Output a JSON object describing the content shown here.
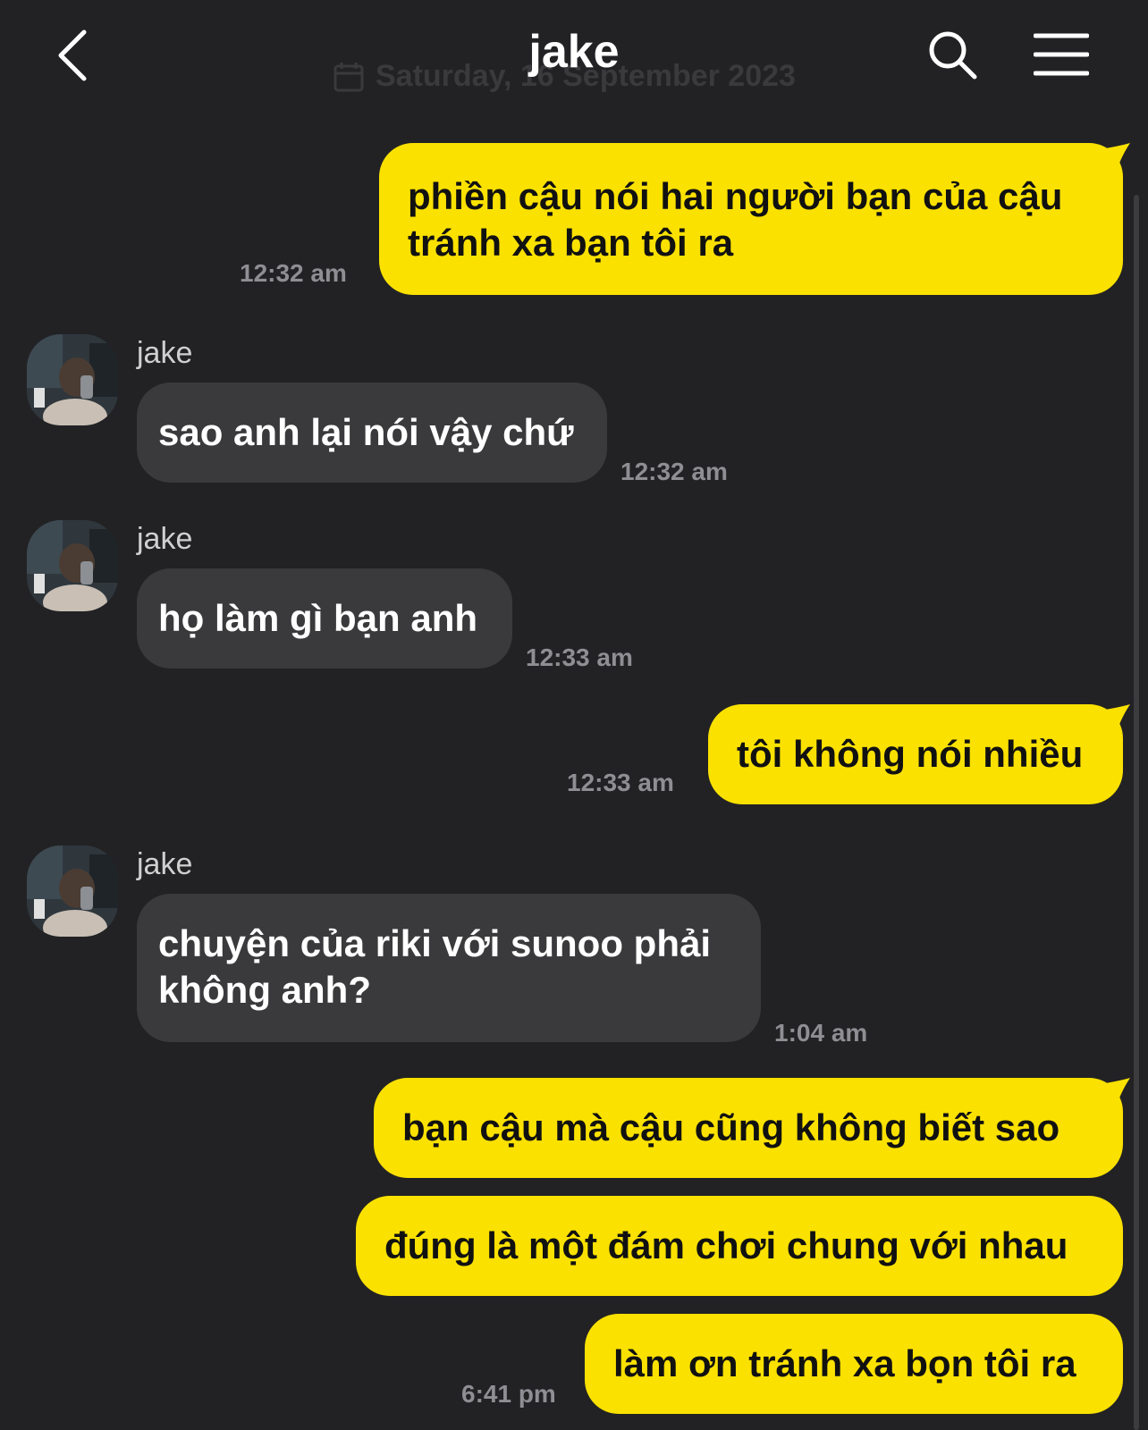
{
  "header": {
    "title": "jake",
    "date": "Saturday, 16 September 2023"
  },
  "messages": [
    {
      "direction": "out",
      "text": "phiền cậu nói hai người bạn của cậu tránh xa bạn tôi ra",
      "time": "12:32 am"
    },
    {
      "direction": "in",
      "sender": "jake",
      "text": "sao anh lại nói vậy chứ",
      "time": "12:32 am"
    },
    {
      "direction": "in",
      "sender": "jake",
      "text": "họ làm gì bạn anh",
      "time": "12:33 am"
    },
    {
      "direction": "out",
      "text": "tôi không nói nhiều",
      "time": "12:33 am"
    },
    {
      "direction": "in",
      "sender": "jake",
      "text": "chuyện của riki với sunoo phải không anh?",
      "time": "1:04 am"
    },
    {
      "direction": "out",
      "text": "bạn cậu mà cậu cũng không biết sao",
      "time": ""
    },
    {
      "direction": "out",
      "text": "đúng là một đám chơi chung với nhau",
      "time": ""
    },
    {
      "direction": "out",
      "text": "làm ơn tránh xa bọn tôi ra",
      "time": "6:41 pm"
    }
  ],
  "icons": {
    "back": "chevron-left-icon",
    "search": "search-icon",
    "menu": "hamburger-menu-icon",
    "calendar": "calendar-icon"
  },
  "colors": {
    "background": "#222224",
    "outgoing_bubble": "#fae100",
    "incoming_bubble": "#3a3a3c",
    "timestamp": "#8e8e93"
  }
}
